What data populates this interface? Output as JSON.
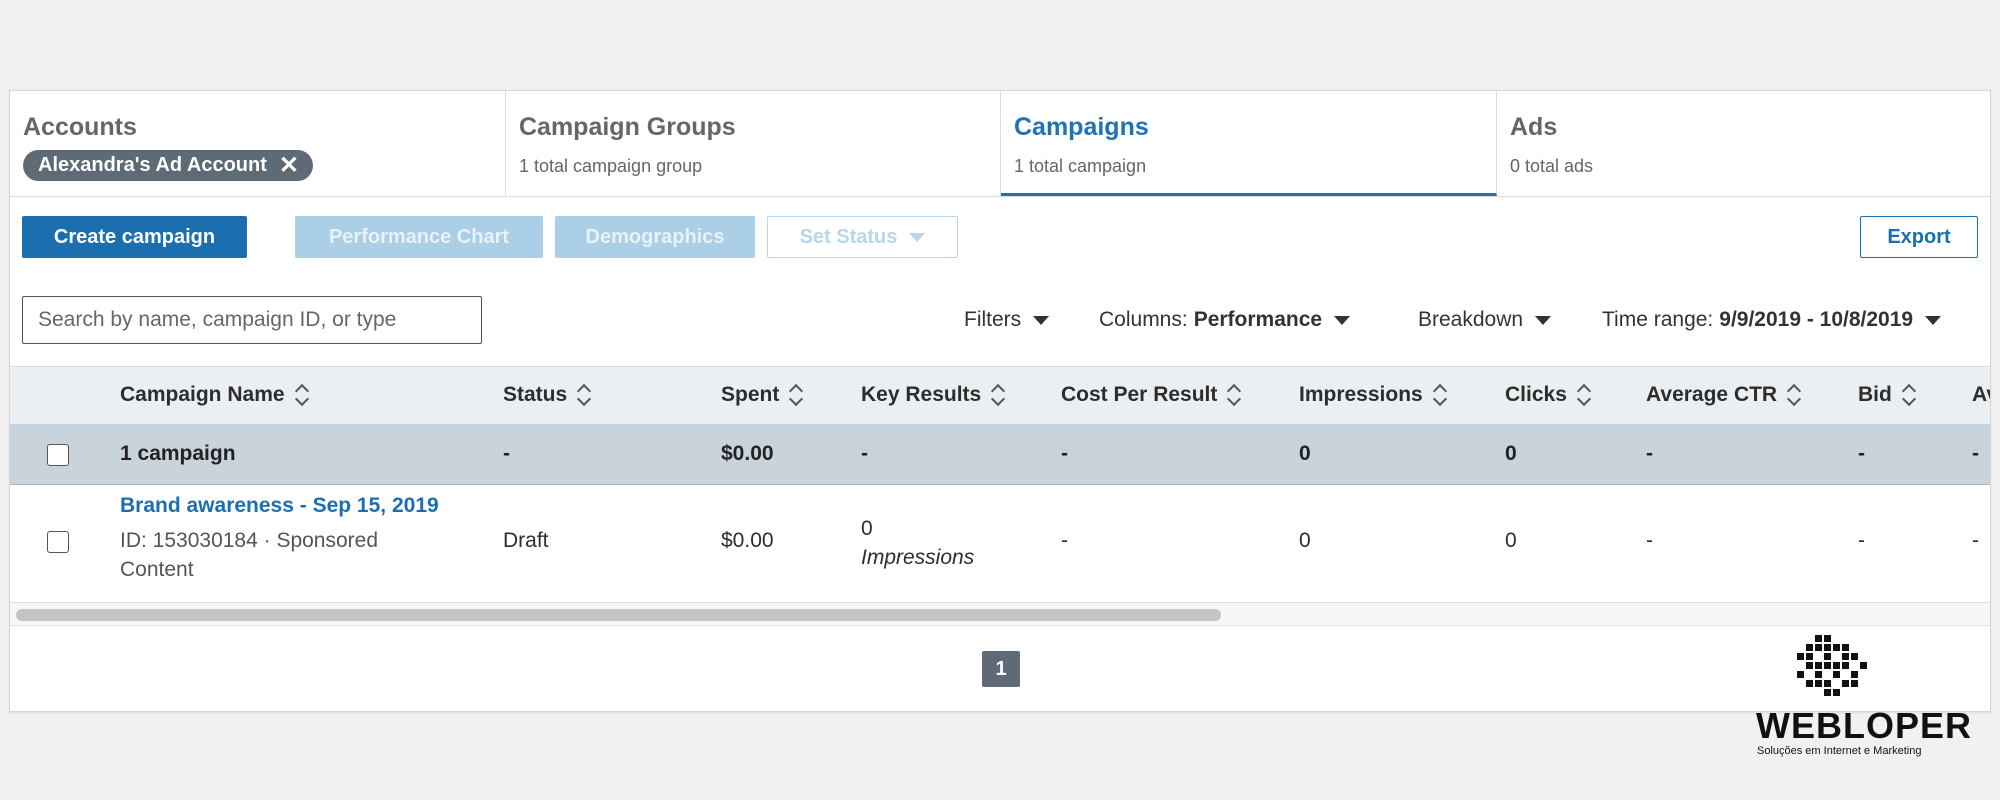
{
  "tabs": [
    {
      "title": "Accounts",
      "chip": "Alexandra's Ad Account"
    },
    {
      "title": "Campaign Groups",
      "sub": "1 total campaign group"
    },
    {
      "title": "Campaigns",
      "sub": "1 total campaign"
    },
    {
      "title": "Ads",
      "sub": "0 total ads"
    }
  ],
  "toolbar": {
    "create": "Create campaign",
    "performance_chart": "Performance Chart",
    "demographics": "Demographics",
    "set_status": "Set Status",
    "export": "Export"
  },
  "search": {
    "placeholder": "Search by name, campaign ID, or type"
  },
  "filters": {
    "filters": "Filters",
    "columns_label": "Columns:",
    "columns_value": "Performance",
    "breakdown": "Breakdown",
    "time_label": "Time range:",
    "time_value": "9/9/2019 - 10/8/2019"
  },
  "table": {
    "headers": [
      "Campaign Name",
      "Status",
      "Spent",
      "Key Results",
      "Cost Per Result",
      "Impressions",
      "Clicks",
      "Average CTR",
      "Bid",
      "Av"
    ],
    "summary": {
      "name": "1 campaign",
      "status": "-",
      "spent": "$0.00",
      "key_results": "-",
      "cost_per_result": "-",
      "impressions": "0",
      "clicks": "0",
      "ctr": "-",
      "bid": "-",
      "avg": "-"
    },
    "rows": [
      {
        "name": "Brand awareness - Sep 15, 2019",
        "meta_line1": "ID: 153030184 · Sponsored",
        "meta_line2": "Content",
        "status": "Draft",
        "spent": "$0.00",
        "key_results_value": "0",
        "key_results_label": "Impressions",
        "cost_per_result": "-",
        "impressions": "0",
        "clicks": "0",
        "ctr": "-",
        "bid": "-",
        "avg": "-"
      }
    ]
  },
  "pagination": {
    "current": "1"
  },
  "logo": {
    "name": "WEBLOPER",
    "tagline": "Soluções em Internet e Marketing"
  },
  "colors": {
    "accent": "#1b6fb0",
    "chip": "#5e6b76",
    "summary_row": "#c8d3dc"
  }
}
